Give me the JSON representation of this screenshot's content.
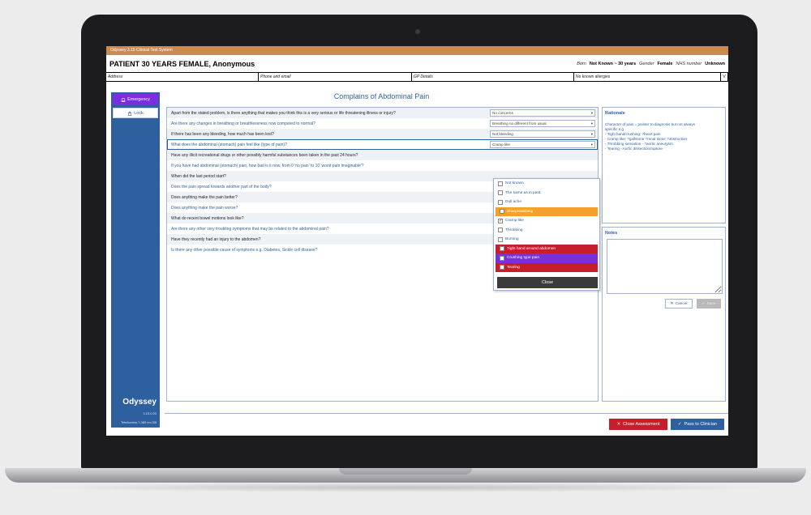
{
  "window": {
    "title": "Odyssey 3.15 Clinical Test System"
  },
  "patient": {
    "name": "PATIENT 30 YEARS FEMALE, Anonymous",
    "born_label": "Born",
    "born_value": "Not Known ~ 30 years",
    "gender_label": "Gender",
    "gender_value": "Female",
    "nhs_label": "NHS number",
    "nhs_value": "Unknown"
  },
  "info_row": {
    "address": "Address",
    "phone": "Phone and email",
    "gp": "GP Details",
    "allergies": "No known allergies",
    "expand": "V"
  },
  "sidebar": {
    "emergency": "Emergency",
    "lock": "Lock",
    "brand": "Odyssey",
    "version": "3.15.0.20",
    "licence": "TeleAccess 7,389 en-GB"
  },
  "page": {
    "title": "Complains of Abdominal Pain"
  },
  "questions": [
    {
      "text": "Apart from the stated problem, is there anything that makes you think this is a very serious or life threatening illness or injury?",
      "answer": "No concerns"
    },
    {
      "text": "Are there any changes in breathing or breathlessness now compared to normal?",
      "answer": "Breathing no different from usual"
    },
    {
      "text": "If there has been any bleeding, how much has been lost?",
      "answer": "Not bleeding"
    },
    {
      "text": "What does the abdominal (stomach) pain feel like (type of pain)?",
      "answer": "Cramp like"
    },
    {
      "text": "Have any illicit recreational drugs or other possibly harmful substances been taken in the past 24 hours?"
    },
    {
      "text": "If you have had abdominal (stomach) pain, how bad is it now, from 0 'no pain' to 10 'worst pain imaginable'?"
    },
    {
      "text": "When did the last period start?"
    },
    {
      "text": "Does the pain spread towards another part of the body?"
    },
    {
      "text": "Does anything make the pain better?"
    },
    {
      "text": "Does anything make the pain worse?"
    },
    {
      "text": "What do recent bowel motions look like?"
    },
    {
      "text": "Are there any other very troubling symptoms that may be related to the abdominal pain?"
    },
    {
      "text": "Have they recently had an injury to the abdomen?"
    },
    {
      "text": "Is there any other possible cause of symptoms e.g. Diabetes, Sickle cell disease?"
    }
  ],
  "dropdown": {
    "options": [
      {
        "label": "Not known",
        "checked": false,
        "style": "plain"
      },
      {
        "label": "The same as in past",
        "checked": false,
        "style": "plain"
      },
      {
        "label": "Dull ache",
        "checked": false,
        "style": "plain"
      },
      {
        "label": "Sharp/stabbing",
        "checked": false,
        "style": "orange"
      },
      {
        "label": "Cramp like",
        "checked": true,
        "style": "plain"
      },
      {
        "label": "Throbbing",
        "checked": false,
        "style": "plain"
      },
      {
        "label": "Burning",
        "checked": false,
        "style": "plain"
      },
      {
        "label": "Tight band around abdomen",
        "checked": false,
        "style": "red"
      },
      {
        "label": "Crushing type pain",
        "checked": false,
        "style": "purple"
      },
      {
        "label": "Tearing",
        "checked": false,
        "style": "red"
      }
    ],
    "close_label": "Close"
  },
  "rationale": {
    "title": "Rationale",
    "lines": [
      "Character of pain = pointer to diagnosis but not always",
      "specific e.g.",
      "- Tight band/crushing: ?heart pain",
      "- Cramp like: ?gallstone ?renal stone ?obstruction",
      "- Throbbing sensation - ?aortic aneurysm",
      "- Tearing - Aortic dissection/rupture"
    ]
  },
  "notes": {
    "title": "Notes",
    "cancel": "Cancel",
    "save": "Save"
  },
  "footer": {
    "close_assessment": "Close Assessment",
    "pass_to_clinician": "Pass to Clinician"
  },
  "colors": {
    "accent": "#2e5f9e",
    "emergency": "#7a2ee0",
    "danger": "#c81e2b",
    "warning": "#f5a02a",
    "titlebar": "#cc8a4e"
  }
}
